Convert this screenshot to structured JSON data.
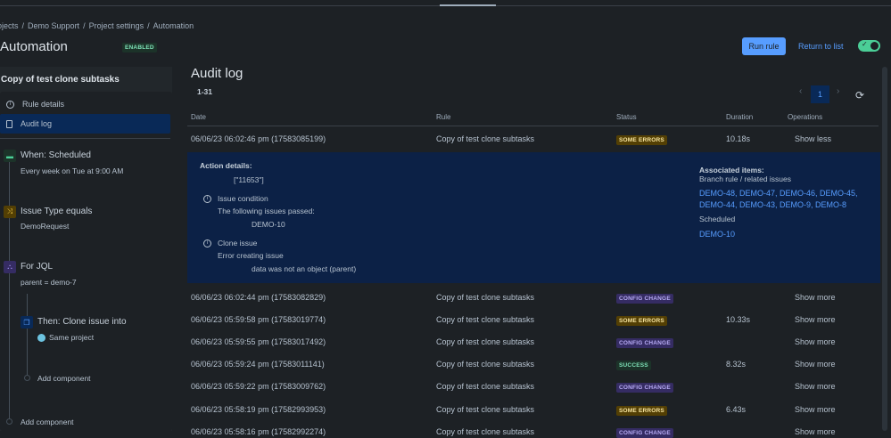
{
  "breadcrumb": [
    "ojects",
    "Demo Support",
    "Project settings",
    "Automation"
  ],
  "header": {
    "title": "Automation",
    "status": "ENABLED",
    "run_rule": "Run rule",
    "return": "Return to list"
  },
  "sidebar": {
    "rule_name": "Copy of test clone subtasks",
    "nav": [
      "Rule details",
      "Audit log"
    ],
    "steps": [
      {
        "title": "When: Scheduled",
        "sub": "Every week on Tue at 9:00 AM"
      },
      {
        "title": "Issue Type equals",
        "sub": "DemoRequest"
      },
      {
        "title": "For JQL",
        "sub": "parent = demo-7"
      },
      {
        "title": "Then: Clone issue into",
        "sub": "Same project"
      }
    ],
    "add_component": "Add component"
  },
  "main": {
    "title": "Audit log",
    "range": "1-31",
    "page": "1",
    "columns": [
      "Date",
      "Rule",
      "Status",
      "Duration",
      "Operations"
    ],
    "first_row": {
      "date": "06/06/23 06:02:46 pm (17583085199)",
      "rule": "Copy of test clone subtasks",
      "status": "SOME ERRORS",
      "duration": "10.18s",
      "op": "Show less"
    },
    "details": {
      "label": "Action details:",
      "value": "[\"11653\"]",
      "cond_title": "Issue condition",
      "cond_sub": "The following issues passed:",
      "cond_issue": "DEMO-10",
      "clone_title": "Clone issue",
      "clone_sub": "Error creating issue",
      "clone_err": "data was not an object (parent)",
      "assoc_label": "Associated items:",
      "assoc_sub": "Branch rule / related issues",
      "assoc_line1": "DEMO-48, DEMO-47, DEMO-46, DEMO-45,",
      "assoc_line2": "DEMO-44, DEMO-43, DEMO-9, DEMO-8",
      "sched": "Scheduled",
      "sched_issue": "DEMO-10"
    },
    "rows": [
      {
        "date": "06/06/23 06:02:44 pm (17583082829)",
        "rule": "Copy of test clone subtasks",
        "status": "CONFIG CHANGE",
        "kind": "cc",
        "duration": "",
        "op": "Show more"
      },
      {
        "date": "06/06/23 05:59:58 pm (17583019774)",
        "rule": "Copy of test clone subtasks",
        "status": "SOME ERRORS",
        "kind": "se",
        "duration": "10.33s",
        "op": "Show more"
      },
      {
        "date": "06/06/23 05:59:55 pm (17583017492)",
        "rule": "Copy of test clone subtasks",
        "status": "CONFIG CHANGE",
        "kind": "cc",
        "duration": "",
        "op": "Show more"
      },
      {
        "date": "06/06/23 05:59:24 pm (17583011141)",
        "rule": "Copy of test clone subtasks",
        "status": "SUCCESS",
        "kind": "su",
        "duration": "8.32s",
        "op": "Show more"
      },
      {
        "date": "06/06/23 05:59:22 pm (17583009762)",
        "rule": "Copy of test clone subtasks",
        "status": "CONFIG CHANGE",
        "kind": "cc",
        "duration": "",
        "op": "Show more"
      },
      {
        "date": "06/06/23 05:58:19 pm (17582993953)",
        "rule": "Copy of test clone subtasks",
        "status": "SOME ERRORS",
        "kind": "se",
        "duration": "6.43s",
        "op": "Show more"
      },
      {
        "date": "06/06/23 05:58:16 pm (17582992274)",
        "rule": "Copy of test clone subtasks",
        "status": "CONFIG CHANGE",
        "kind": "cc",
        "duration": "",
        "op": "Show more"
      }
    ]
  }
}
